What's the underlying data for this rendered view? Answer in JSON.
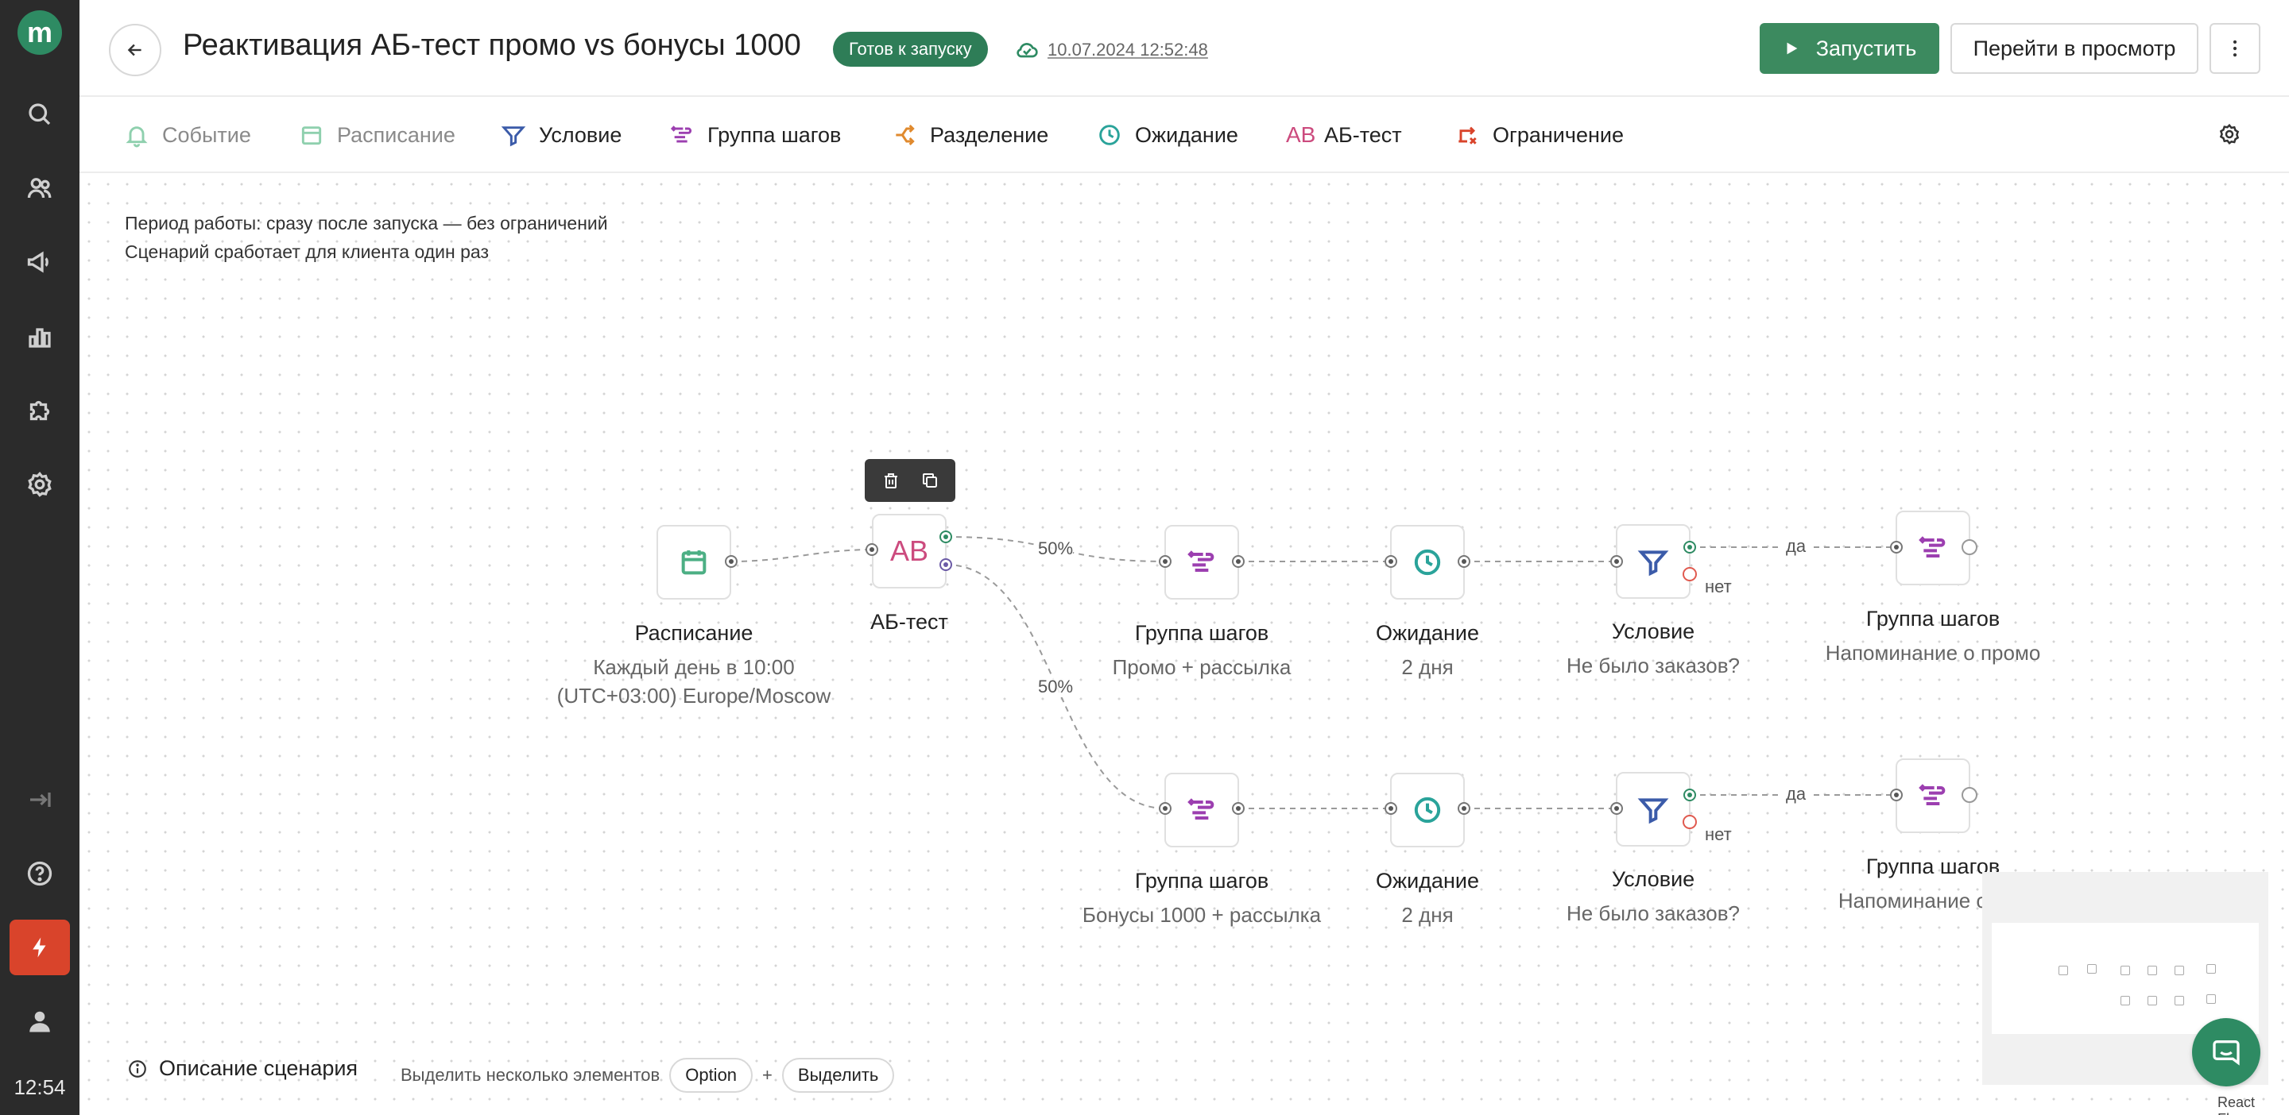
{
  "app": {
    "logo_letter": "m",
    "clock": "12:54"
  },
  "header": {
    "title": "Реактивация АБ-тест промо vs бонусы 1000",
    "status_badge": "Готов к запуску",
    "saved_at": "10.07.2024 12:52:48",
    "run_label": "Запустить",
    "preview_label": "Перейти в просмотр"
  },
  "toolbar": {
    "items": [
      {
        "label": "Событие",
        "icon": "bell-icon",
        "color": "#4caf84"
      },
      {
        "label": "Расписание",
        "icon": "calendar-icon",
        "color": "#4caf84"
      },
      {
        "label": "Условие",
        "icon": "filter-icon",
        "color": "#3b5ba9"
      },
      {
        "label": "Группа шагов",
        "icon": "group-icon",
        "color": "#9c3fb0"
      },
      {
        "label": "Разделение",
        "icon": "split-icon",
        "color": "#e08a2e"
      },
      {
        "label": "Ожидание",
        "icon": "clock-icon",
        "color": "#2aa39a"
      },
      {
        "label": "АБ-тест",
        "icon": "ab-icon",
        "color": "#cc4b7e"
      },
      {
        "label": "Ограничение",
        "icon": "limit-icon",
        "color": "#d9442b"
      }
    ]
  },
  "canvas": {
    "info": {
      "period": "Период работы: сразу после запуска — без ограничений",
      "once": "Сценарий сработает для клиента один раз"
    },
    "nodes": {
      "schedule": {
        "title": "Расписание",
        "sub1": "Каждый день в 10:00",
        "sub2": "(UTC+03:00) Europe/Moscow"
      },
      "abtest": {
        "title": "АБ-тест",
        "icon_text": "AB"
      },
      "group_a": {
        "title": "Группа шагов",
        "sub": "Промо + рассылка"
      },
      "wait_a": {
        "title": "Ожидание",
        "sub": "2 дня"
      },
      "cond_a": {
        "title": "Условие",
        "sub": "Не было заказов?"
      },
      "remind_a": {
        "title": "Группа шагов",
        "sub": "Напоминание о промо"
      },
      "group_b": {
        "title": "Группа шагов",
        "sub": "Бонусы 1000 + рассылка"
      },
      "wait_b": {
        "title": "Ожидание",
        "sub": "2 дня"
      },
      "cond_b": {
        "title": "Условие",
        "sub": "Не было заказов?"
      },
      "remind_b": {
        "title": "Группа шагов",
        "sub": "Напоминание о про"
      }
    },
    "edges": {
      "split_a": "50%",
      "split_b": "50%",
      "yes": "да",
      "no": "нет"
    }
  },
  "footer": {
    "description_label": "Описание сценария",
    "multi_select_hint": "Выделить несколько элементов",
    "key_option": "Option",
    "plus": "+",
    "key_select": "Выделить"
  },
  "attribution": "React Flow"
}
